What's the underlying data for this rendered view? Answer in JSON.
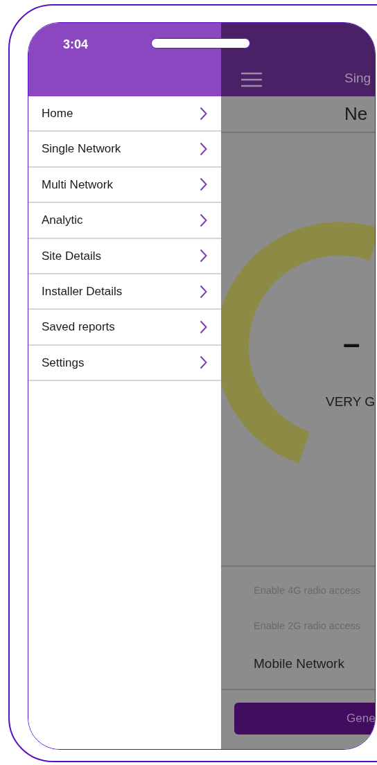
{
  "status_bar": {
    "time": "3:04"
  },
  "drawer": {
    "items": [
      {
        "label": "Home"
      },
      {
        "label": "Single Network"
      },
      {
        "label": "Multi Network"
      },
      {
        "label": "Analytic"
      },
      {
        "label": "Site Details"
      },
      {
        "label": "Installer Details"
      },
      {
        "label": "Saved reports"
      },
      {
        "label": "Settings"
      }
    ]
  },
  "background_screen": {
    "title_bar": "Sing",
    "heading": "Ne",
    "gauge": {
      "value": "–",
      "rating": "VERY G"
    },
    "rows": [
      {
        "kind": "option",
        "label": "Enable 4G radio access"
      },
      {
        "kind": "option",
        "label": "Enable 2G radio access"
      },
      {
        "kind": "header",
        "label": "Mobile Network"
      }
    ],
    "button": "Gene"
  }
}
